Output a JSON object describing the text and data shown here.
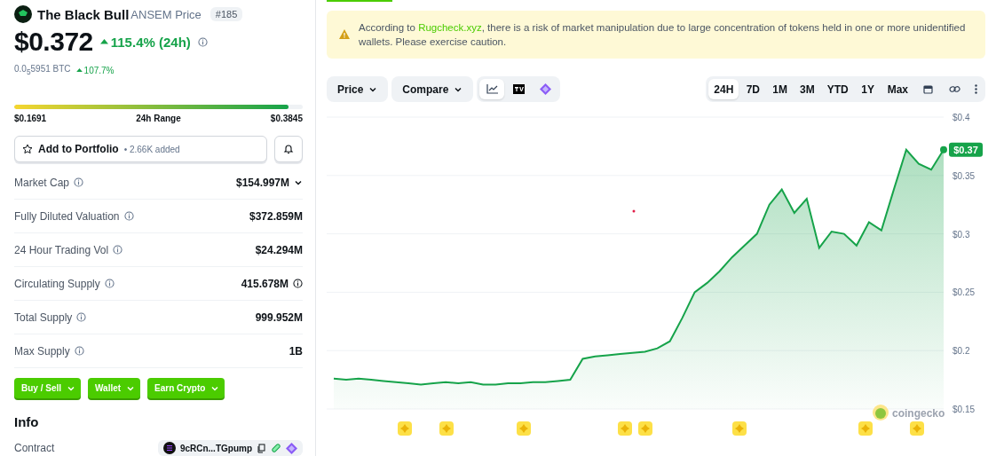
{
  "coin": {
    "name": "The Black Bull",
    "subtitle": "ANSEM Price",
    "rank": "#185",
    "price": "$0.372",
    "change": "115.4% (24h)",
    "btc_price": "0.0$_{5}$5951 BTC",
    "btc_change": "107.7%"
  },
  "range": {
    "low": "$0.1691",
    "label": "24h Range",
    "high": "$0.3845",
    "level": 0.95
  },
  "portfolio": {
    "label": "Add to Portfolio",
    "count": "• 2.66K added"
  },
  "stats": [
    {
      "label": "Market Cap",
      "value": "$154.997M",
      "dropdown": true
    },
    {
      "label": "Fully Diluted Valuation",
      "value": "$372.859M"
    },
    {
      "label": "24 Hour Trading Vol",
      "value": "$24.294M"
    },
    {
      "label": "Circulating Supply",
      "value": "415.678M",
      "value_info": true
    },
    {
      "label": "Total Supply",
      "value": "999.952M"
    },
    {
      "label": "Max Supply",
      "value": "1B"
    }
  ],
  "actions": [
    "Buy / Sell",
    "Wallet",
    "Earn Crypto"
  ],
  "info": {
    "title": "Info",
    "contract_label": "Contract",
    "contract": "9cRCn...TGpump"
  },
  "alert": {
    "before": "According to ",
    "link": "Rugcheck.xyz",
    "after": ", there is a risk of market manipulation due to large concentration of tokens held in one or more unidentified wallets. Please exercise caution."
  },
  "toolbar": {
    "dropdowns": [
      "Price",
      "Compare"
    ],
    "chart_types": [
      {
        "kind": "line",
        "selected": true
      },
      {
        "kind": "tradingview",
        "selected": false
      },
      {
        "kind": "gem",
        "selected": false
      }
    ],
    "ranges": [
      {
        "label": "24H",
        "selected": true
      },
      {
        "label": "7D",
        "selected": false
      },
      {
        "label": "1M",
        "selected": false
      },
      {
        "label": "3M",
        "selected": false
      },
      {
        "label": "YTD",
        "selected": false
      },
      {
        "label": "1Y",
        "selected": false
      },
      {
        "label": "Max",
        "selected": false
      }
    ]
  },
  "chart": {
    "current_label": "$0.37",
    "watermark": "coingecko",
    "chart_data": {
      "type": "area",
      "grid": true,
      "ylim": [
        0.15,
        0.4
      ],
      "yticks": [
        {
          "value": 0.4,
          "label": "$0.4"
        },
        {
          "value": 0.35,
          "label": "$0.35"
        },
        {
          "value": 0.3,
          "label": "$0.3"
        },
        {
          "value": 0.25,
          "label": "$0.25"
        },
        {
          "value": 0.2,
          "label": "$0.2"
        },
        {
          "value": 0.15,
          "label": "$0.15"
        }
      ],
      "series": [
        {
          "color": "#16a34a",
          "values": [
            0.176,
            0.175,
            0.176,
            0.175,
            0.174,
            0.173,
            0.172,
            0.171,
            0.172,
            0.173,
            0.172,
            0.173,
            0.171,
            0.171,
            0.172,
            0.172,
            0.173,
            0.173,
            0.174,
            0.175,
            0.193,
            0.195,
            0.196,
            0.197,
            0.198,
            0.199,
            0.202,
            0.208,
            0.228,
            0.25,
            0.258,
            0.268,
            0.28,
            0.29,
            0.3,
            0.325,
            0.338,
            0.318,
            0.33,
            0.288,
            0.302,
            0.3,
            0.29,
            0.31,
            0.303,
            0.338,
            0.372,
            0.36,
            0.355,
            0.372
          ]
        }
      ]
    }
  }
}
